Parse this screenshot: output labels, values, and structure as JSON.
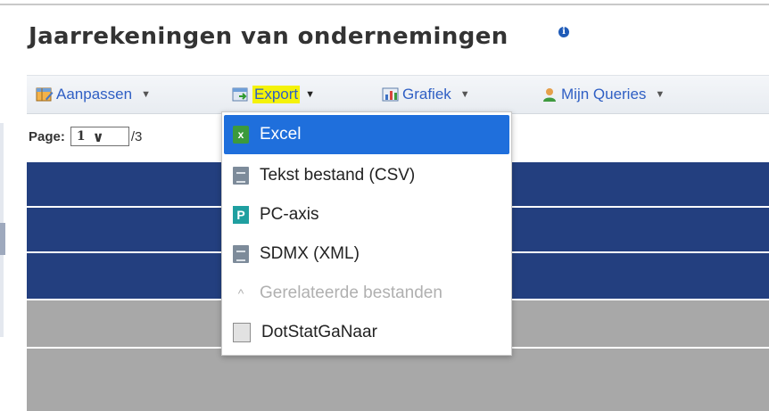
{
  "page": {
    "title": "Jaarrekeningen van ondernemingen",
    "info_icon": "info-icon"
  },
  "toolbar": {
    "customize_label": "Aanpassen",
    "export_label": "Export",
    "chart_label": "Grafiek",
    "queries_label": "Mijn Queries",
    "highlight_color": "#f4f20a"
  },
  "pager": {
    "label": "Page:",
    "current": "1",
    "total": "/3"
  },
  "export_menu": {
    "items": [
      {
        "label": "Excel",
        "icon": "excel-icon",
        "state": "highlighted"
      },
      {
        "label": "Tekst bestand (CSV)",
        "icon": "text-file-icon",
        "state": "enabled"
      },
      {
        "label": "PC-axis",
        "icon": "pc-axis-icon",
        "state": "enabled"
      },
      {
        "label": "SDMX (XML)",
        "icon": "xml-file-icon",
        "state": "enabled"
      },
      {
        "label": "Gerelateerde bestanden",
        "icon": "chevron-up-icon",
        "state": "disabled"
      },
      {
        "label": "DotStatGaNaar",
        "icon": "dotstat-icon",
        "state": "enabled"
      }
    ]
  },
  "colors": {
    "header_rows": "#233f7f",
    "body_rows": "#a8a8a8",
    "menu_highlight": "#1f6fdc"
  }
}
